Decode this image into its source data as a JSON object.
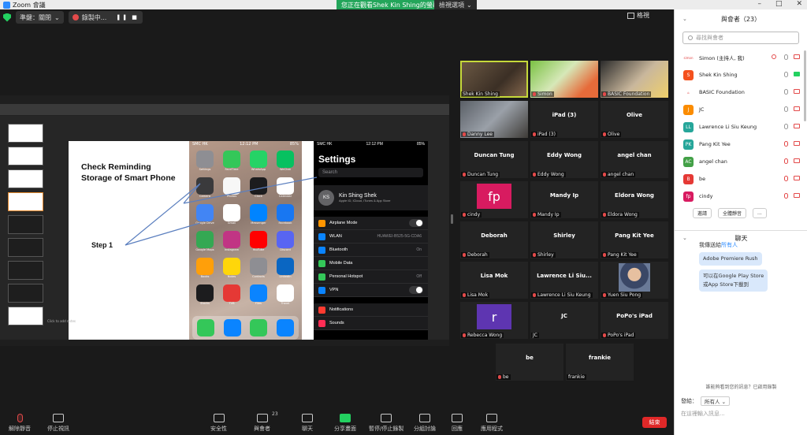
{
  "titlebar": {
    "title": "Zoom 會議"
  },
  "banner": {
    "viewing": "您正在觀看Shek Kin Shing的螢幕",
    "view_options": "檢視選項"
  },
  "meeting": {
    "pill_label": "準鍵：關閉",
    "recording_label": "錄製中..."
  },
  "gallery": {
    "label": "格視"
  },
  "slide": {
    "title_line1": "Check Reminding",
    "title_line2": "Storage of Smart Phone",
    "step1": "Step 1",
    "step2": "2",
    "notes": "Click to add notes"
  },
  "phone": {
    "time": "12:12 PM",
    "carrier": "SMC HK",
    "battery": "85%",
    "apps": [
      "Settings",
      "FaceTime",
      "WhatsApp",
      "WeChat",
      "Camera",
      "Photos",
      "Clock",
      "Calendar",
      "Google Drive",
      "Gmail",
      "Messenger",
      "Facebook",
      "Google Maps",
      "Instagram",
      "YouTube",
      "Discord",
      "Books",
      "Notes",
      "Contacts",
      "LinkedIn",
      "Stocks",
      "TVB",
      "Files",
      "Travel"
    ],
    "app_colors": [
      "#8e8e93",
      "#34c759",
      "#25d366",
      "#07c160",
      "#3a3a3c",
      "#f7f7f7",
      "#1c1c1e",
      "#ffffff",
      "#4285f4",
      "#ffffff",
      "#0084ff",
      "#1877f2",
      "#34a853",
      "#c13584",
      "#ff0000",
      "#5865f2",
      "#ff9f0a",
      "#ffd60a",
      "#8e8e93",
      "#0a66c2",
      "#1c1c1e",
      "#e53935",
      "#0a84ff",
      "#ffffff"
    ],
    "dock_colors": [
      "#34c759",
      "#0a84ff",
      "#34c759",
      "#0a84ff"
    ]
  },
  "settings": {
    "title": "Settings",
    "search": "Search",
    "initials": "KS",
    "name": "Kin Shing Shek",
    "sub": "Apple ID, iCloud, iTunes & App Store",
    "rows": [
      {
        "label": "Airplane Mode",
        "value": "",
        "color": "#ff9500",
        "toggle": true
      },
      {
        "label": "WLAN",
        "value": "HUAWEI-B525-5G-CDA6",
        "color": "#0a84ff",
        "toggle": false
      },
      {
        "label": "Bluetooth",
        "value": "On",
        "color": "#0a84ff",
        "toggle": false
      },
      {
        "label": "Mobile Data",
        "value": "",
        "color": "#34c759",
        "toggle": false
      },
      {
        "label": "Personal Hotspot",
        "value": "Off",
        "color": "#34c759",
        "toggle": false
      },
      {
        "label": "VPN",
        "value": "",
        "color": "#0a84ff",
        "toggle": true
      }
    ],
    "rows2": [
      {
        "label": "Notifications",
        "value": "",
        "color": "#ff3b30",
        "toggle": false
      },
      {
        "label": "Sounds",
        "value": "",
        "color": "#ff2d55",
        "toggle": false
      }
    ]
  },
  "tiles": [
    {
      "name": "Shek Kin Shing",
      "center": "",
      "kind": "video",
      "active": true,
      "muted": false
    },
    {
      "name": "Simon",
      "center": "",
      "kind": "video2",
      "active": false,
      "muted": true
    },
    {
      "name": "BASIC Foundation",
      "center": "",
      "kind": "video3",
      "active": false,
      "muted": true
    },
    {
      "name": "Danny Lee",
      "center": "",
      "kind": "video4",
      "active": false,
      "muted": true
    },
    {
      "name": "iPad (3)",
      "center": "iPad (3)",
      "kind": "text",
      "active": false,
      "muted": true
    },
    {
      "name": "Olive",
      "center": "Olive",
      "kind": "text",
      "active": false,
      "muted": true
    },
    {
      "name": "Duncan Tung",
      "center": "Duncan Tung",
      "kind": "text",
      "active": false,
      "muted": true
    },
    {
      "name": "Eddy Wong",
      "center": "Eddy Wong",
      "kind": "text",
      "active": false,
      "muted": true
    },
    {
      "name": "angel chan",
      "center": "angel chan",
      "kind": "text",
      "active": false,
      "muted": true
    },
    {
      "name": "cindy",
      "center": "fp",
      "kind": "square",
      "active": false,
      "muted": true,
      "color": "#d81b60"
    },
    {
      "name": "Mandy Ip",
      "center": "Mandy Ip",
      "kind": "text",
      "active": false,
      "muted": true
    },
    {
      "name": "Eldora Wong",
      "center": "Eldora Wong",
      "kind": "text",
      "active": false,
      "muted": true
    },
    {
      "name": "Deborah",
      "center": "Deborah",
      "kind": "text",
      "active": false,
      "muted": true
    },
    {
      "name": "Shirley",
      "center": "Shirley",
      "kind": "text",
      "active": false,
      "muted": true
    },
    {
      "name": "Pang Kit Yee",
      "center": "Pang Kit Yee",
      "kind": "text",
      "active": false,
      "muted": true
    },
    {
      "name": "Lisa Mok",
      "center": "Lisa Mok",
      "kind": "text",
      "active": false,
      "muted": true
    },
    {
      "name": "Lawrence Li Siu Keung",
      "center": "Lawrence  Li Siu...",
      "kind": "text",
      "active": false,
      "muted": true
    },
    {
      "name": "Yuen Siu Pong",
      "center": "",
      "kind": "photo",
      "active": false,
      "muted": true
    },
    {
      "name": "Rebecca Wong",
      "center": "r",
      "kind": "square",
      "active": false,
      "muted": true,
      "color": "#5e35b1"
    },
    {
      "name": "JC",
      "center": "JC",
      "kind": "text",
      "active": false,
      "muted": false
    },
    {
      "name": "PoPo's iPad",
      "center": "PoPo's iPad",
      "kind": "text",
      "active": false,
      "muted": true
    },
    {
      "name": "be",
      "center": "be",
      "kind": "text",
      "active": false,
      "muted": true
    },
    {
      "name": "frankie",
      "center": "frankie",
      "kind": "text",
      "active": false,
      "muted": false
    }
  ],
  "toolbar": {
    "mute": "解除靜音",
    "video": "停止視訊",
    "security": "安全性",
    "participants": "與會者",
    "participants_count": "23",
    "chat": "聊天",
    "share": "分享畫面",
    "record": "暫停/停止錄製",
    "breakout": "分組討論",
    "reactions": "回應",
    "apps": "應用程式",
    "end": "結束"
  },
  "participants_panel": {
    "title": "與會者（23）",
    "search_placeholder": "尋找與會者",
    "people": [
      {
        "name": "Simon (主持人, 我)",
        "initials": "simon",
        "color": "#ffffff",
        "text_color": "#e34a4a",
        "mic_off": false,
        "cam_on": false,
        "rec": true
      },
      {
        "name": "Shek Kin Shing",
        "initials": "S",
        "color": "#f4511e",
        "text_color": "#ffffff",
        "mic_off": false,
        "cam_on": true,
        "rec": false
      },
      {
        "name": "BASIC Foundation",
        "initials": "⌂",
        "color": "#ffffff",
        "text_color": "#e34a4a",
        "mic_off": false,
        "cam_on": false,
        "rec": false
      },
      {
        "name": "JC",
        "initials": "J",
        "color": "#fb8c00",
        "text_color": "#ffffff",
        "mic_off": false,
        "cam_on": false,
        "rec": false
      },
      {
        "name": "Lawrence Li Siu Keung",
        "initials": "LL",
        "color": "#26a69a",
        "text_color": "#ffffff",
        "mic_off": false,
        "cam_on": false,
        "rec": false
      },
      {
        "name": "Pang Kit Yee",
        "initials": "PK",
        "color": "#26a69a",
        "text_color": "#ffffff",
        "mic_off": true,
        "cam_on": false,
        "rec": false
      },
      {
        "name": "angel chan",
        "initials": "AC",
        "color": "#43a047",
        "text_color": "#ffffff",
        "mic_off": true,
        "cam_on": false,
        "rec": false
      },
      {
        "name": "be",
        "initials": "B",
        "color": "#e53935",
        "text_color": "#ffffff",
        "mic_off": true,
        "cam_on": false,
        "rec": false
      },
      {
        "name": "cindy",
        "initials": "fp",
        "color": "#d81b60",
        "text_color": "#ffffff",
        "mic_off": true,
        "cam_on": false,
        "rec": false
      }
    ],
    "btn_invite": "邀請",
    "btn_mute_all": "全體靜音",
    "btn_more": "..."
  },
  "chat": {
    "title": "聊天",
    "from_prefix": "我傳送給",
    "from_target": "所有人",
    "messages": [
      "Adobe Premiere Rush",
      "可以在Google Play Store\n或App Store下載到"
    ],
    "note": "誰能夠看到您的訊息？已啟用錄製",
    "to_label": "發給：",
    "to_value": "所有人",
    "input_placeholder": "在這裡輸入訊息..."
  }
}
